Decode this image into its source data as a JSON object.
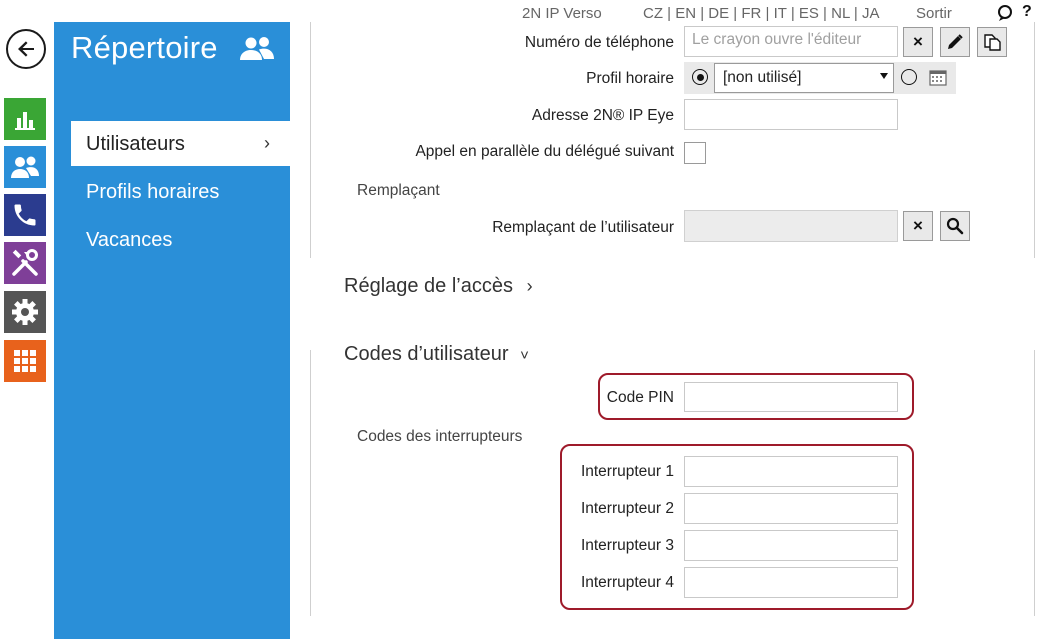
{
  "topbar": {
    "product": "2N IP Verso",
    "languages": "CZ | EN | DE | FR | IT | ES | NL | JA",
    "logout": "Sortir",
    "help": "?"
  },
  "sidebar": {
    "title": "Répertoire",
    "items": [
      {
        "label": "Utilisateurs",
        "active": true,
        "chevron": "›"
      },
      {
        "label": "Profils horaires",
        "active": false
      },
      {
        "label": "Vacances",
        "active": false
      }
    ]
  },
  "rail": {
    "icons": [
      {
        "name": "back-icon"
      },
      {
        "name": "status-chart-icon",
        "color": "#3aa635"
      },
      {
        "name": "directory-users-icon",
        "color": "#2a8fd8"
      },
      {
        "name": "phone-icon",
        "color": "#2b3c8f"
      },
      {
        "name": "hardware-tools-icon",
        "color": "#7f3f98"
      },
      {
        "name": "settings-gear-icon",
        "color": "#555555"
      },
      {
        "name": "services-grid-icon",
        "color": "#e8621c"
      }
    ]
  },
  "form": {
    "phone": {
      "label": "Numéro de téléphone",
      "placeholder": "Le crayon ouvre l'éditeur",
      "clear": "×"
    },
    "time_profile": {
      "label": "Profil horaire",
      "value": "[non utilisé]"
    },
    "ip_eye": {
      "label": "Adresse 2N® IP Eye",
      "value": ""
    },
    "parallel": {
      "label": "Appel en parallèle du délégué suivant",
      "checked": false
    },
    "deputy_heading": "Remplaçant",
    "deputy": {
      "label": "Remplaçant de l’utilisateur",
      "value": "",
      "clear": "×"
    },
    "access_section": "Réglage de l’accès",
    "access_chevron": "›",
    "codes_section": "Codes d’utilisateur",
    "codes_chevron": "˅",
    "pin": {
      "label": "Code PIN",
      "value": ""
    },
    "switch_codes_heading": "Codes des interrupteurs",
    "switches": [
      {
        "label": "Interrupteur 1",
        "value": ""
      },
      {
        "label": "Interrupteur 2",
        "value": ""
      },
      {
        "label": "Interrupteur 3",
        "value": ""
      },
      {
        "label": "Interrupteur 4",
        "value": ""
      }
    ]
  },
  "colors": {
    "sidebar_blue": "#2a8fd8",
    "highlight_red": "#9e1a2a"
  }
}
